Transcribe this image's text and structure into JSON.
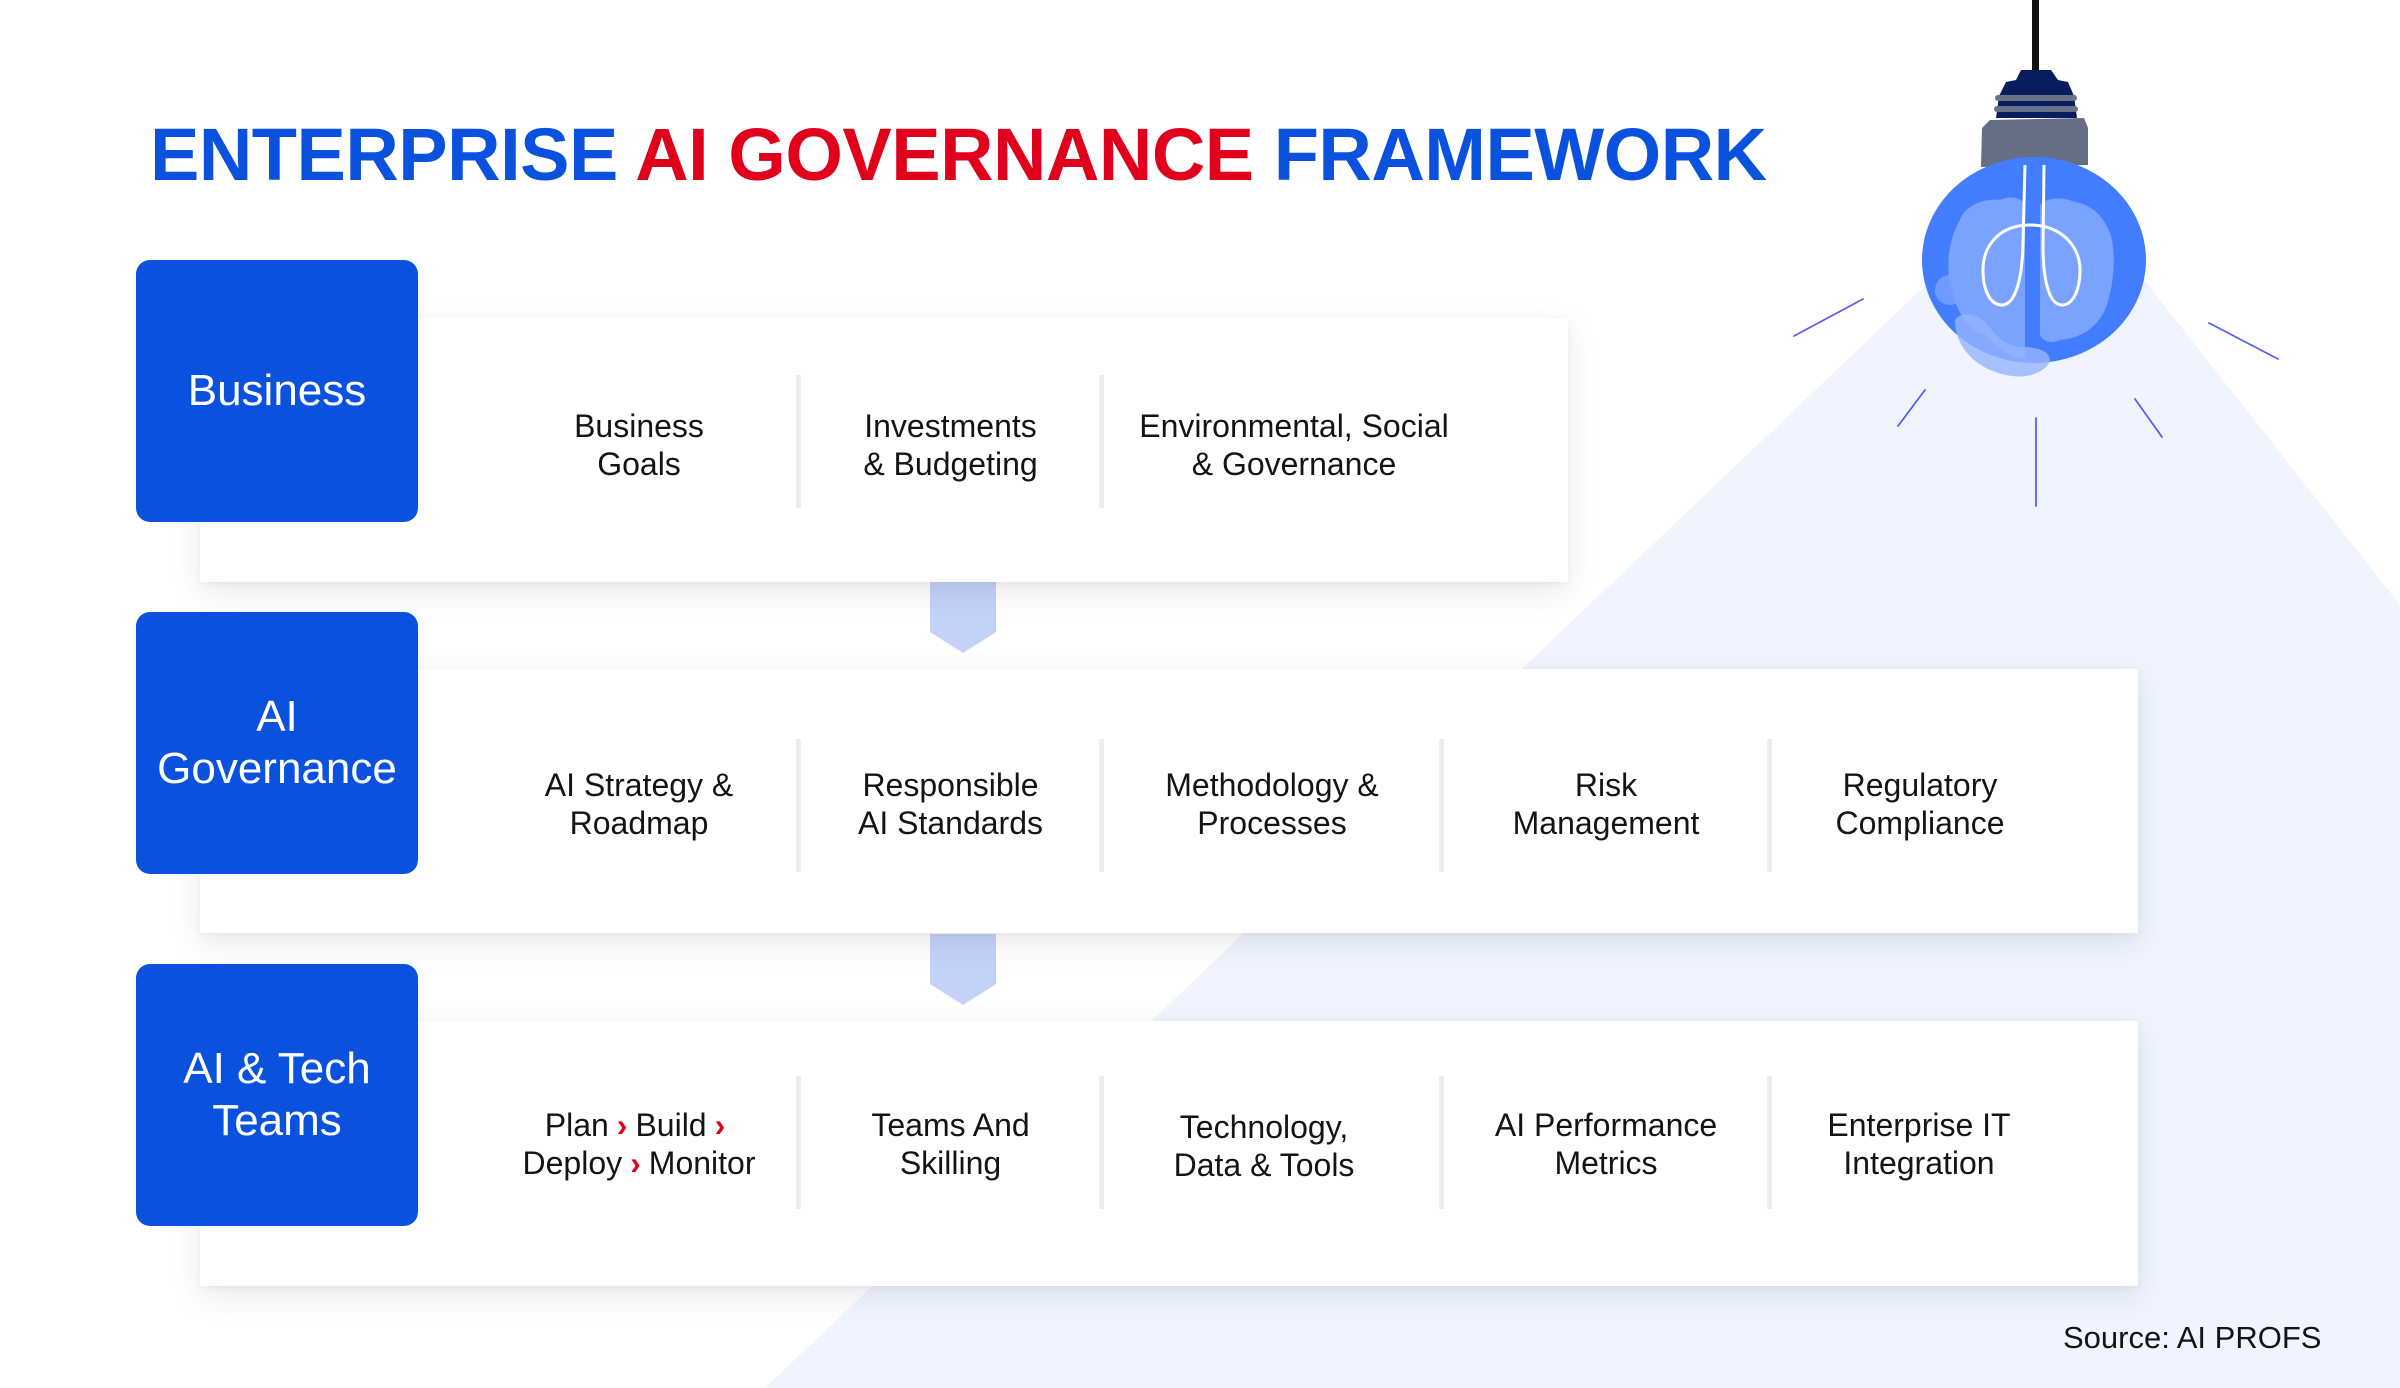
{
  "title": {
    "part1": "ENTERPRISE",
    "part2": "AI GOVERNANCE",
    "part3": "FRAMEWORK"
  },
  "colors": {
    "primary_blue": "#0a52de",
    "accent_red": "#e0001b",
    "card_bg": "#ffffff",
    "light_beam": "#eff4fe",
    "arrow_fill": "#c3d2f7",
    "bulb_blue": "#437dff"
  },
  "layers": [
    {
      "name": "Business",
      "items": [
        {
          "text": "Business\nGoals"
        },
        {
          "text": "Investments\n& Budgeting"
        },
        {
          "text": "Environmental, Social\n& Governance"
        }
      ]
    },
    {
      "name": "AI Governance",
      "name_lines": [
        "AI",
        "Governance"
      ],
      "items": [
        {
          "text": "AI Strategy &\nRoadmap"
        },
        {
          "text": "Responsible\nAI Standards"
        },
        {
          "text": "Methodology &\nProcesses"
        },
        {
          "text": "Risk\nManagement"
        },
        {
          "text": "Regulatory\nCompliance"
        }
      ]
    },
    {
      "name": "AI & Tech Teams",
      "name_lines": [
        "AI & Tech",
        "Teams"
      ],
      "items": [
        {
          "lifecycle": {
            "steps": [
              "Plan",
              "Build",
              "Deploy",
              "Monitor"
            ],
            "separator": "›"
          }
        },
        {
          "text": "Teams And\nSkilling"
        },
        {
          "text": "Technology,\nData & Tools"
        },
        {
          "text": "AI Performance\nMetrics"
        },
        {
          "text": "Enterprise IT\nIntegration"
        }
      ]
    }
  ],
  "connectors": [
    {
      "from": "Business",
      "to": "AI Governance",
      "icon": "down-arrow-icon"
    },
    {
      "from": "AI Governance",
      "to": "AI & Tech Teams",
      "icon": "down-arrow-icon"
    }
  ],
  "illustration": {
    "icon": "lightbulb-brain-icon"
  },
  "source": "Source: AI PROFS"
}
